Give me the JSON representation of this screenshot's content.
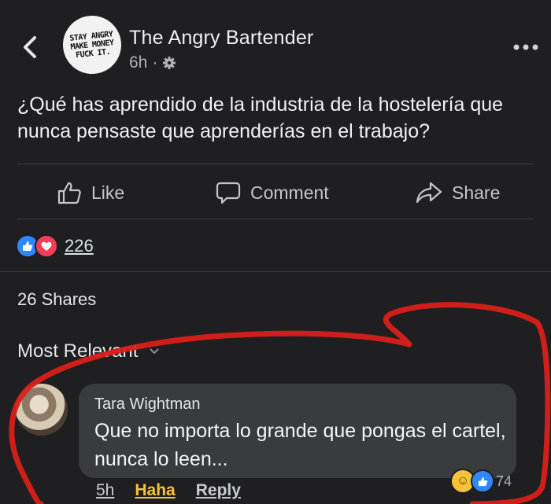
{
  "header": {
    "page_name": "The Angry Bartender",
    "time": "6h",
    "separator": "·",
    "avatar_lines": [
      "STAY ANGRY",
      "MAKE MONEY",
      "FUCK IT."
    ]
  },
  "post": {
    "text": "¿Qué has aprendido de la industria de la hostelería que nunca pensaste que aprenderías en el trabajo?"
  },
  "actions": {
    "like_label": "Like",
    "comment_label": "Comment",
    "share_label": "Share"
  },
  "stats": {
    "reaction_count": "226",
    "shares": "26 Shares"
  },
  "comments": {
    "sort_label": "Most Relevant",
    "items": [
      {
        "author": "Tara Wightman",
        "text": "Que no importa lo grande que pongas el cartel, nunca lo leen...",
        "time": "5h",
        "reaction_label": "Haha",
        "reply_label": "Reply",
        "reaction_count": "74"
      }
    ]
  },
  "colors": {
    "background": "#1f1f21",
    "like_blue": "#2d88ff",
    "love_red": "#f33e58",
    "annotation_red": "#d8201a"
  }
}
